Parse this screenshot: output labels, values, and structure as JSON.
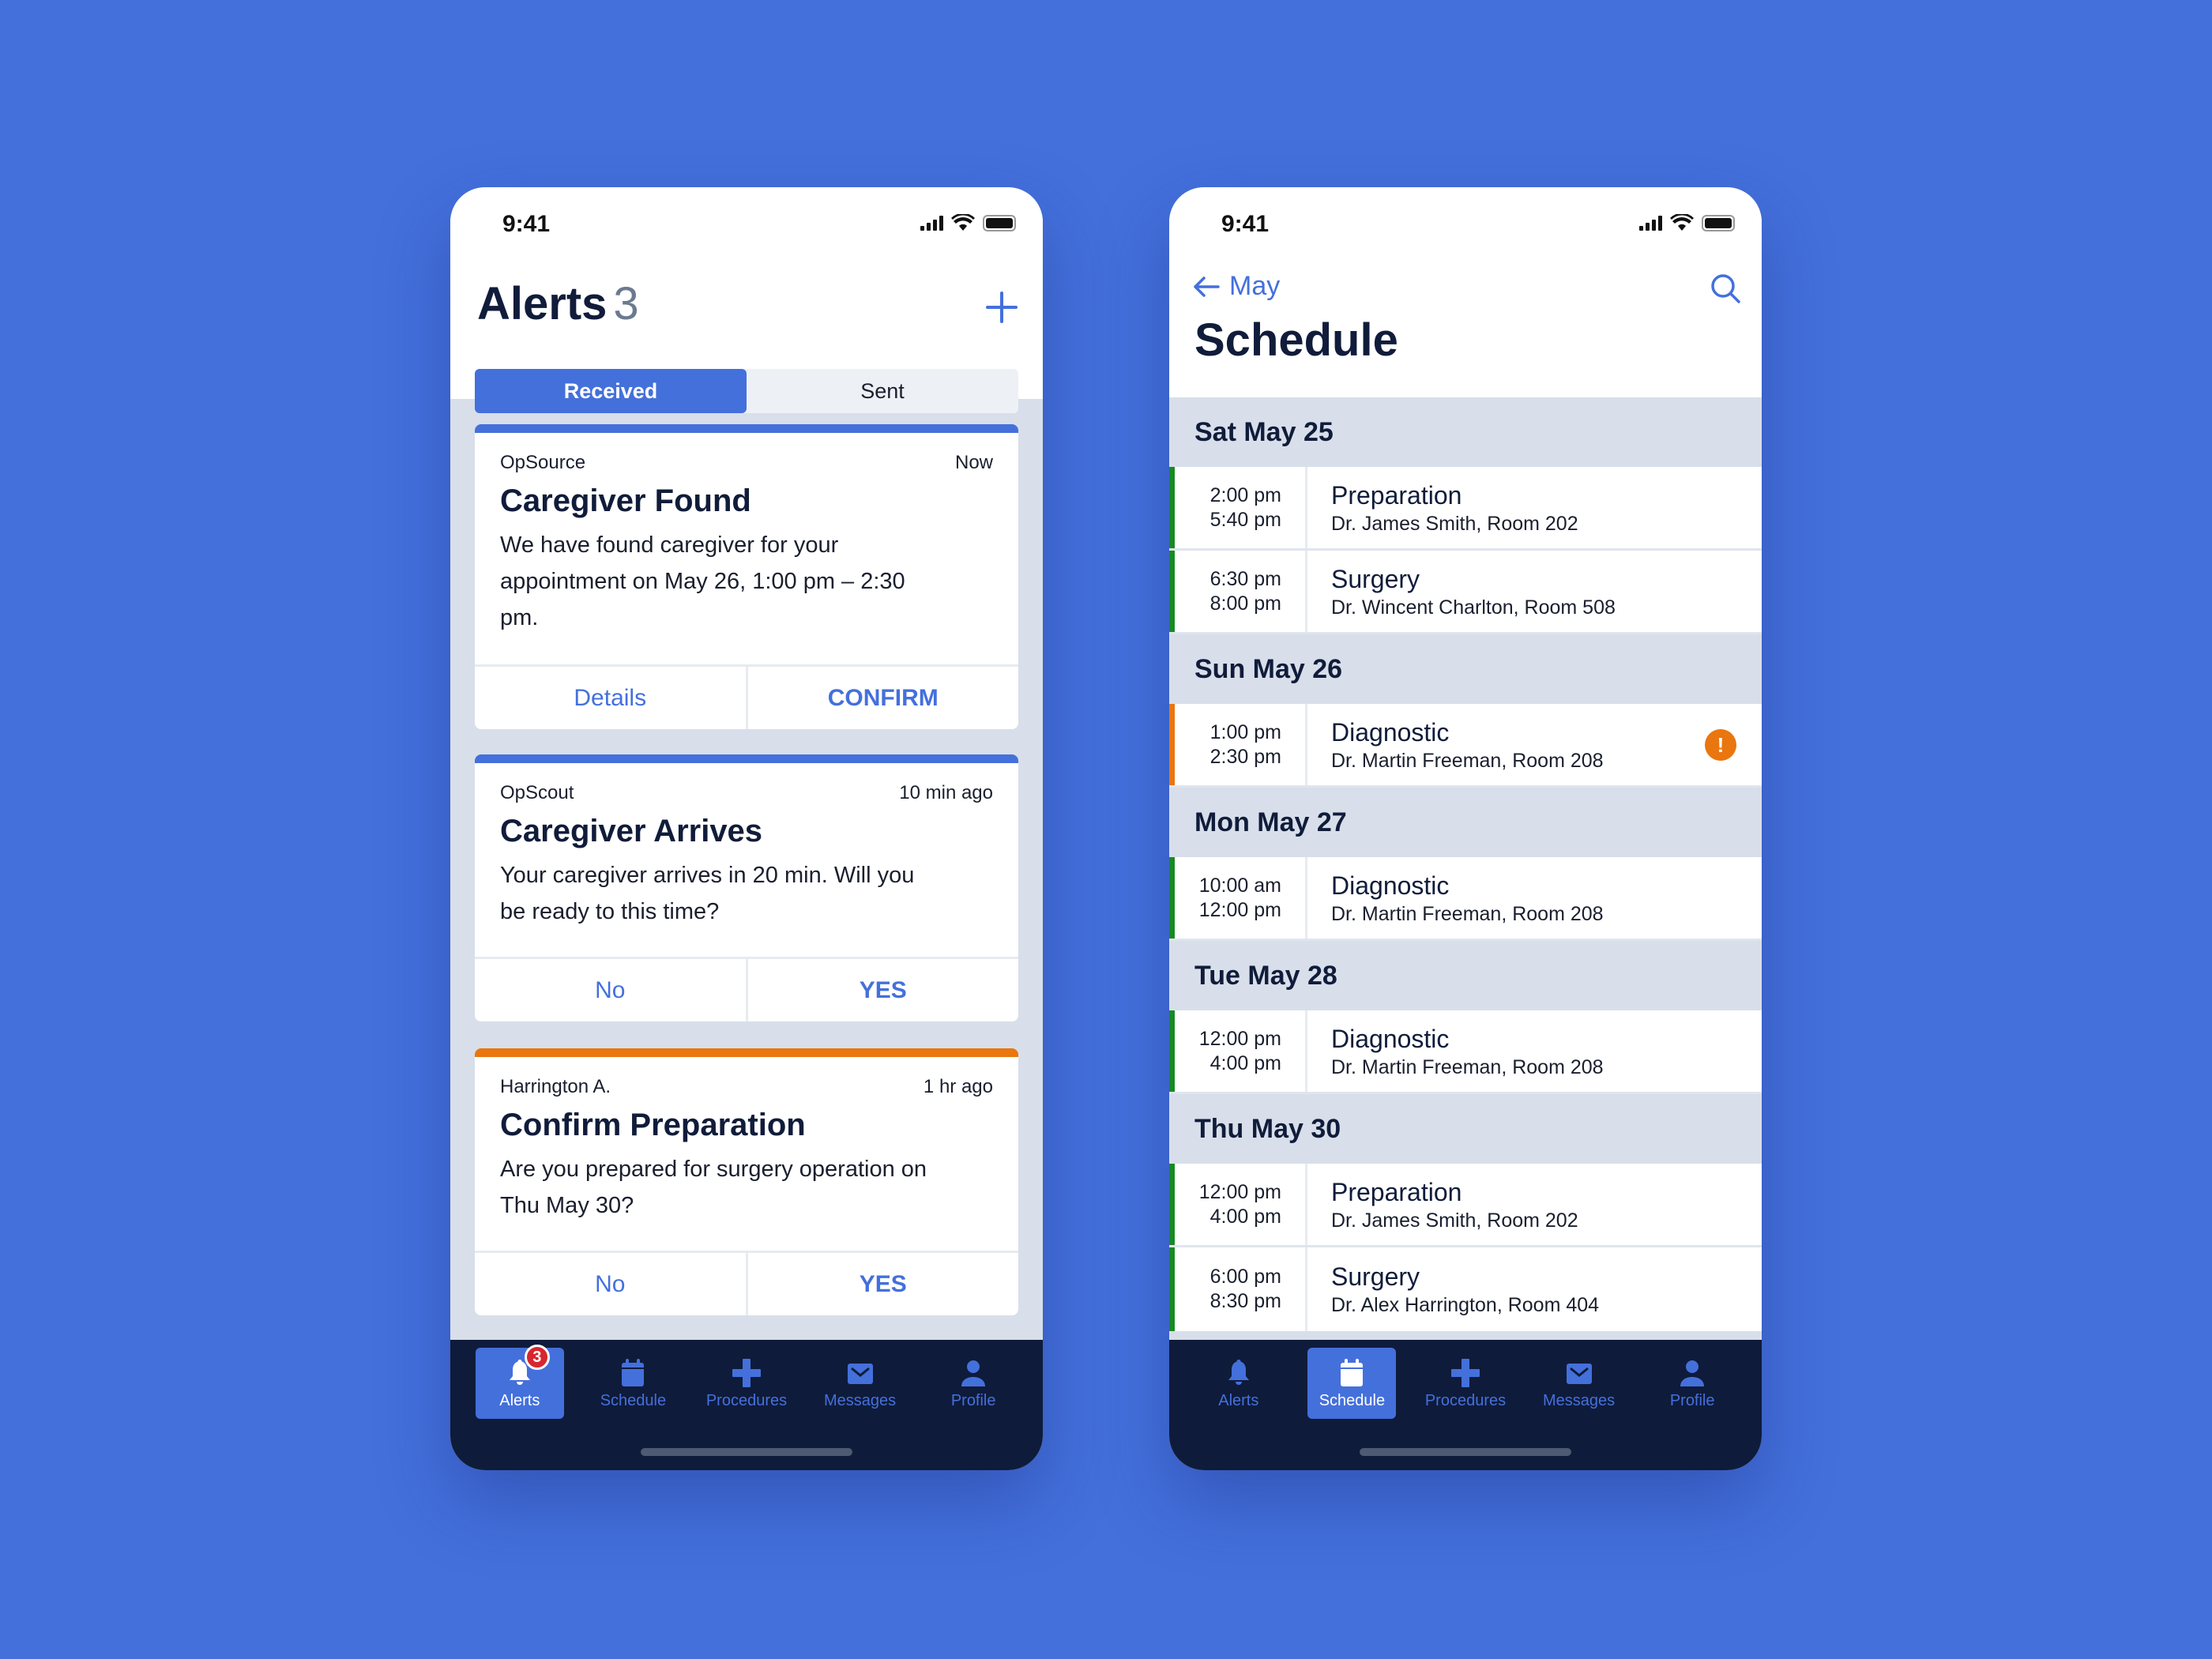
{
  "alerts_screen": {
    "status_time": "9:41",
    "title": "Alerts",
    "count": "3",
    "tabs": [
      {
        "label": "Received",
        "active": true
      },
      {
        "label": "Sent",
        "active": false
      }
    ],
    "cards": [
      {
        "source": "OpSource",
        "time": "Now",
        "title": "Caregiver Found",
        "body": "We have found caregiver for your appointment on May 26, 1:00 pm – 2:30 pm.",
        "secondary_action": "Details",
        "primary_action": "CONFIRM",
        "accent": "#4470dc"
      },
      {
        "source": "OpScout",
        "time": "10 min ago",
        "title": "Caregiver Arrives",
        "body": "Your caregiver arrives in 20 min. Will you be ready to this time?",
        "secondary_action": "No",
        "primary_action": "YES",
        "accent": "#4470dc"
      },
      {
        "source": "Harrington A.",
        "time": "1 hr ago",
        "title": "Confirm Preparation",
        "body": "Are you prepared for surgery operation on Thu May 30?",
        "secondary_action": "No",
        "primary_action": "YES",
        "accent": "#e9760f"
      }
    ],
    "tabbar": {
      "active": "Alerts",
      "badge": "3",
      "items": [
        {
          "label": "Alerts",
          "icon": "bell-icon"
        },
        {
          "label": "Schedule",
          "icon": "calendar-icon"
        },
        {
          "label": "Procedures",
          "icon": "plus-cross-icon"
        },
        {
          "label": "Messages",
          "icon": "envelope-icon"
        },
        {
          "label": "Profile",
          "icon": "person-icon"
        }
      ]
    }
  },
  "schedule_screen": {
    "status_time": "9:41",
    "back_label": "May",
    "title": "Schedule",
    "days": [
      {
        "label": "Sat May 25",
        "events": [
          {
            "start": "2:00 pm",
            "end": "5:40 pm",
            "name": "Preparation",
            "location": "Dr. James Smith, Room 202",
            "status": "ok"
          },
          {
            "start": "6:30 pm",
            "end": "8:00 pm",
            "name": "Surgery",
            "location": "Dr. Wincent Charlton, Room 508",
            "status": "ok"
          }
        ]
      },
      {
        "label": "Sun May 26",
        "events": [
          {
            "start": "1:00 pm",
            "end": "2:30 pm",
            "name": "Diagnostic",
            "location": "Dr. Martin Freeman, Room 208",
            "status": "warning"
          }
        ]
      },
      {
        "label": "Mon May 27",
        "events": [
          {
            "start": "10:00 am",
            "end": "12:00 pm",
            "name": "Diagnostic",
            "location": "Dr. Martin Freeman, Room 208",
            "status": "ok"
          }
        ]
      },
      {
        "label": "Tue May 28",
        "events": [
          {
            "start": "12:00 pm",
            "end": "4:00 pm",
            "name": "Diagnostic",
            "location": "Dr. Martin Freeman, Room 208",
            "status": "ok"
          }
        ]
      },
      {
        "label": "Thu May 30",
        "events": [
          {
            "start": "12:00 pm",
            "end": "4:00 pm",
            "name": "Preparation",
            "location": "Dr. James Smith, Room 202",
            "status": "ok"
          },
          {
            "start": "6:00 pm",
            "end": "8:30 pm",
            "name": "Surgery",
            "location": "Dr. Alex Harrington, Room 404",
            "status": "ok"
          }
        ]
      }
    ],
    "warning_glyph": "!",
    "tabbar": {
      "active": "Schedule",
      "items": [
        {
          "label": "Alerts",
          "icon": "bell-icon"
        },
        {
          "label": "Schedule",
          "icon": "calendar-icon"
        },
        {
          "label": "Procedures",
          "icon": "plus-cross-icon"
        },
        {
          "label": "Messages",
          "icon": "envelope-icon"
        },
        {
          "label": "Profile",
          "icon": "person-icon"
        }
      ]
    }
  },
  "colors": {
    "background": "#4470dc",
    "accent": "#4470dc",
    "tabbar": "#0f1b3a",
    "ok": "#188a22",
    "warning": "#e9760f",
    "badge": "#d7262e"
  }
}
